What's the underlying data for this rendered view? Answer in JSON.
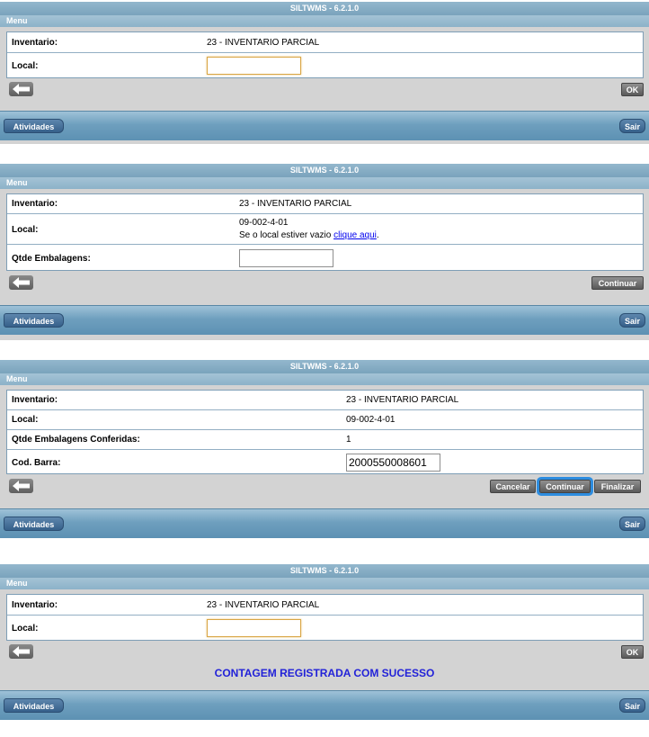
{
  "app_title": "SILTWMS - 6.2.1.0",
  "menu_label": "Menu",
  "footer": {
    "activities_label": "Atividades",
    "exit_label": "Sair"
  },
  "screen1": {
    "inventory_label": "Inventario:",
    "inventory_value": "23 - INVENTARIO PARCIAL",
    "local_label": "Local:",
    "local_value": "",
    "ok_label": "OK"
  },
  "screen2": {
    "inventory_label": "Inventario:",
    "inventory_value": "23 - INVENTARIO PARCIAL",
    "local_label": "Local:",
    "local_value": "09-002-4-01",
    "empty_text": "Se o local estiver vazio ",
    "empty_link": "clique aqui",
    "empty_tail": ".",
    "qty_label": "Qtde Embalagens:",
    "qty_value": "",
    "continue_label": "Continuar"
  },
  "screen3": {
    "inventory_label": "Inventario:",
    "inventory_value": "23 - INVENTARIO PARCIAL",
    "local_label": "Local:",
    "local_value": "09-002-4-01",
    "checked_label": "Qtde Embalagens Conferidas:",
    "checked_value": "1",
    "barcode_label": "Cod. Barra:",
    "barcode_value": "2000550008601",
    "cancel_label": "Cancelar",
    "continue_label": "Continuar",
    "finish_label": "Finalizar"
  },
  "screen4": {
    "inventory_label": "Inventario:",
    "inventory_value": "23 - INVENTARIO PARCIAL",
    "local_label": "Local:",
    "local_value": "",
    "ok_label": "OK",
    "success_message": "CONTAGEM REGISTRADA COM SUCESSO"
  }
}
